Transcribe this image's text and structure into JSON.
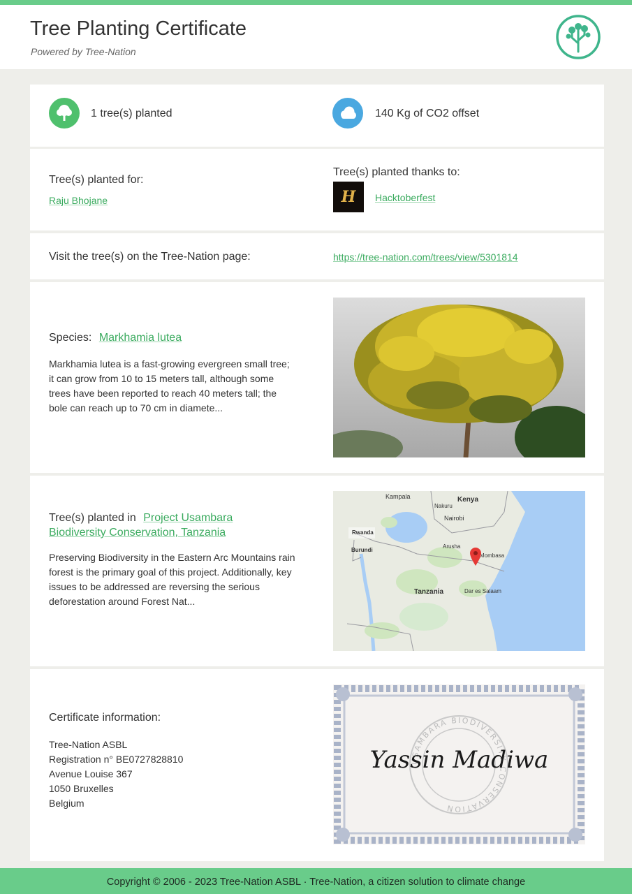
{
  "header": {
    "title": "Tree Planting Certificate",
    "powered_by": "Powered by Tree-Nation",
    "logo_icon": "tree-nation-logo-icon"
  },
  "stats": {
    "trees": "1 tree(s) planted",
    "co2": "140 Kg of CO2 offset",
    "tree_icon": "tree-icon",
    "cloud_icon": "cloud-icon"
  },
  "planted_for": {
    "label": "Tree(s) planted for:",
    "name": "Raju Bhojane"
  },
  "thanks_to": {
    "label": "Tree(s) planted thanks to:",
    "sponsor_logo_text": "H",
    "sponsor": "Hacktoberfest"
  },
  "visit": {
    "label": "Visit the tree(s) on the Tree-Nation page:",
    "url": "https://tree-nation.com/trees/view/5301814"
  },
  "species": {
    "label": "Species:",
    "name": "Markhamia lutea",
    "description": "Markhamia lutea is a fast-growing evergreen small tree; it can grow from 10 to 15 meters tall, although some trees have been reported to reach 40 meters tall; the bole can reach up to 70 cm in diamete..."
  },
  "project": {
    "label": "Tree(s) planted in",
    "name": "Project Usambara Biodiversity Conservation, Tanzania",
    "description": "Preserving Biodiversity in the Eastern Arc Mountains rain forest is the primary goal of this project. Additionally, key issues to be addressed are reversing the serious deforestation around Forest Nat...",
    "map_labels": {
      "kampala": "Kampala",
      "kenya": "Kenya",
      "nakuru": "Nakuru",
      "nairobi": "Nairobi",
      "rwanda": "Rwanda",
      "burundi": "Burundi",
      "arusha": "Arusha",
      "mombasa": "Mombasa",
      "tanzania": "Tanzania",
      "dar": "Dar es Salaam"
    }
  },
  "certificate": {
    "label": "Certificate information:",
    "org": "Tree-Nation ASBL",
    "registration": "Registration n° BE0727828810",
    "street": "Avenue Louise 367",
    "city": "1050 Bruxelles",
    "country": "Belgium",
    "signature": "Yassin Madiwa",
    "seal_text": "USAMBARA BIODIVERSITY CONSERVATION"
  },
  "footer": {
    "text": "Copyright © 2006 - 2023 Tree-Nation ASBL ·  Tree-Nation, a citizen solution to climate change"
  },
  "colors": {
    "accent": "#69cc8a",
    "link": "#3bab5f",
    "tree_icon_bg": "#4fc06d",
    "cloud_icon_bg": "#4aa8e0"
  }
}
